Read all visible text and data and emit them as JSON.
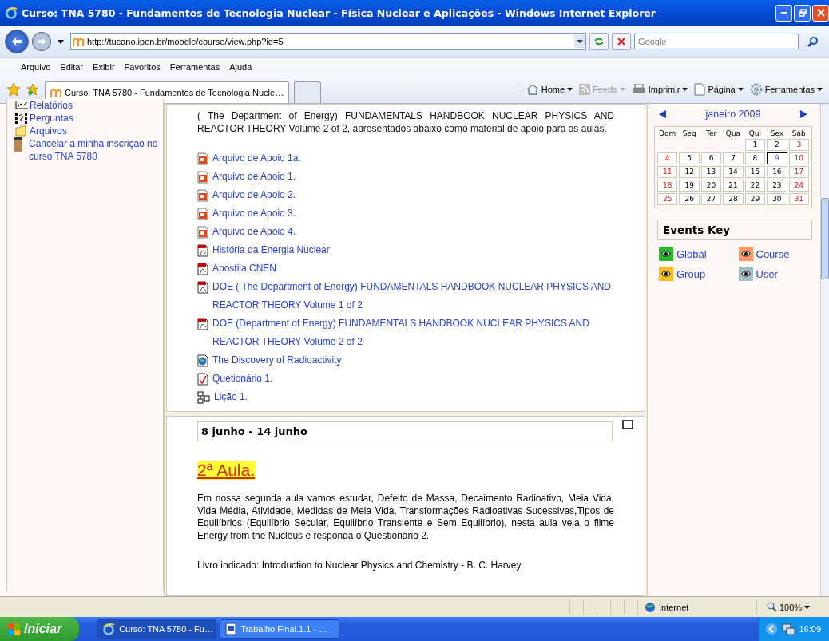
{
  "window": {
    "title": "Curso: TNA 5780 - Fundamentos de Tecnologia Nuclear - Física Nuclear e Aplicações - Windows Internet Explorer"
  },
  "address_bar": {
    "url": "http://tucano.ipen.br/moodle/course/view.php?id=5",
    "search_placeholder": "Google"
  },
  "menu_bar": [
    "Arquivo",
    "Editar",
    "Exibir",
    "Favoritos",
    "Ferramentas",
    "Ajuda"
  ],
  "tabs": [
    {
      "label": "Curso: TNA 5780 - Fundamentos de Tecnologia Nucle…",
      "selected": true
    }
  ],
  "command_bar": [
    {
      "label": "Home",
      "kind": "home",
      "disabled": false
    },
    {
      "label": "Feeds",
      "kind": "feeds",
      "disabled": true
    },
    {
      "label": "Imprimir",
      "kind": "print",
      "disabled": false
    },
    {
      "label": "Página",
      "kind": "page",
      "disabled": false
    },
    {
      "label": "Ferramentas",
      "kind": "tools",
      "disabled": false
    }
  ],
  "sidebar": {
    "items": [
      {
        "label": "Relatórios",
        "kind": "chart"
      },
      {
        "label": "Perguntas",
        "kind": "questions"
      },
      {
        "label": "Arquivos",
        "kind": "folder"
      },
      {
        "label": "Cancelar a minha inscrição no curso TNA 5780",
        "kind": "person"
      }
    ]
  },
  "section_1": {
    "intro": "( The Department of Energy) FUNDAMENTALS HANDBOOK NUCLEAR PHYSICS AND REACTOR THEORY Volume 2 of 2, apresentados abaixo como material de apoio para as aulas.",
    "resources": [
      {
        "label": "Arquivo de Apoio 1a.",
        "kind": "slides"
      },
      {
        "label": "Arquivo de Apoio 1.",
        "kind": "slides"
      },
      {
        "label": "Arquivo de Apoio 2.",
        "kind": "slides"
      },
      {
        "label": "Arquivo de Apoio 3.",
        "kind": "slides"
      },
      {
        "label": "Arquivo de Apoio 4.",
        "kind": "slides"
      },
      {
        "label": "História da Energia Nuclear",
        "kind": "pdf"
      },
      {
        "label": "Apostila CNEN",
        "kind": "pdf"
      },
      {
        "label": "DOE ( The Department of Energy) FUNDAMENTALS HANDBOOK NUCLEAR PHYSICS AND REACTOR THEORY Volume 1 of 2",
        "kind": "pdf"
      },
      {
        "label": "DOE (Department of Energy) FUNDAMENTALS HANDBOOK NUCLEAR PHYSICS AND REACTOR THEORY Volume 2 of 2",
        "kind": "pdf"
      },
      {
        "label": "The Discovery of Radioactivity",
        "kind": "web"
      },
      {
        "label": "Quetionário 1.",
        "kind": "quiz"
      },
      {
        "label": "Lição 1.",
        "kind": "lesson"
      }
    ]
  },
  "section_2": {
    "dates": "8 junho - 14 junho",
    "heading": "2ª Aula.",
    "text": "Em nossa segunda aula vamos estudar, Defeito de Massa, Decaimento Radioativo, Meia Vida, Vida Média, Atividade, Medidas de Meia Vida, Transformações Radioativas Sucessivas,Tipos de Equilíbrios (Equilíbrio Secular, Equilíbrio Transiente e Sem Equilíbrio), nesta aula veja o filme  Energy from the Nucleus e responda o Questionário 2.",
    "book": "Livro indicado: Introduction to Nuclear Physics and Chemistry - B. C. Harvey"
  },
  "calendar": {
    "month": "janeiro 2009",
    "weekdays": [
      "Dom",
      "Seg",
      "Ter",
      "Qua",
      "Qui",
      "Sex",
      "Sáb"
    ],
    "weeks": [
      {
        "kind": "partial",
        "days": [
          {
            "day": "1",
            "weekend": false,
            "today": false
          },
          {
            "day": "2",
            "weekend": false,
            "today": false
          },
          {
            "day": "3",
            "weekend": true,
            "today": false
          }
        ]
      },
      {
        "kind": "full",
        "days": [
          {
            "day": "4",
            "weekend": true,
            "today": false
          },
          {
            "day": "5",
            "weekend": false,
            "today": false
          },
          {
            "day": "6",
            "weekend": false,
            "today": false
          },
          {
            "day": "7",
            "weekend": false,
            "today": false
          },
          {
            "day": "8",
            "weekend": false,
            "today": false
          },
          {
            "day": "9",
            "weekend": false,
            "today": true
          },
          {
            "day": "10",
            "weekend": true,
            "today": false
          }
        ]
      },
      {
        "kind": "full",
        "days": [
          {
            "day": "11",
            "weekend": true,
            "today": false
          },
          {
            "day": "12",
            "weekend": false,
            "today": false
          },
          {
            "day": "13",
            "weekend": false,
            "today": false
          },
          {
            "day": "14",
            "weekend": false,
            "today": false
          },
          {
            "day": "15",
            "weekend": false,
            "today": false
          },
          {
            "day": "16",
            "weekend": false,
            "today": false
          },
          {
            "day": "17",
            "weekend": true,
            "today": false
          }
        ]
      },
      {
        "kind": "full",
        "days": [
          {
            "day": "18",
            "weekend": true,
            "today": false
          },
          {
            "day": "19",
            "weekend": false,
            "today": false
          },
          {
            "day": "20",
            "weekend": false,
            "today": false
          },
          {
            "day": "21",
            "weekend": false,
            "today": false
          },
          {
            "day": "22",
            "weekend": false,
            "today": false
          },
          {
            "day": "23",
            "weekend": false,
            "today": false
          },
          {
            "day": "24",
            "weekend": true,
            "today": false
          }
        ]
      },
      {
        "kind": "full",
        "days": [
          {
            "day": "25",
            "weekend": true,
            "today": false
          },
          {
            "day": "26",
            "weekend": false,
            "today": false
          },
          {
            "day": "27",
            "weekend": false,
            "today": false
          },
          {
            "day": "28",
            "weekend": false,
            "today": false
          },
          {
            "day": "29",
            "weekend": false,
            "today": false
          },
          {
            "day": "30",
            "weekend": false,
            "today": false
          },
          {
            "day": "31",
            "weekend": true,
            "today": false
          }
        ]
      }
    ]
  },
  "events_key": {
    "title": "Events Key",
    "items": [
      {
        "label": "Global",
        "color": "#2eb82e"
      },
      {
        "label": "Course",
        "color": "#ff9966"
      },
      {
        "label": "Group",
        "color": "#fbbb23"
      },
      {
        "label": "User",
        "color": "#a1bec6"
      }
    ]
  },
  "status_bar": {
    "zone": "Internet",
    "zoom": "100%"
  },
  "taskbar": {
    "start": "Iniciar",
    "windows": [
      {
        "label": "Curso: TNA 5780 - Fu…",
        "kind": "browser",
        "selected": true
      },
      {
        "label": "Trabalho Final.1.1 - …",
        "kind": "document",
        "selected": false
      }
    ],
    "clock": "16:09"
  }
}
